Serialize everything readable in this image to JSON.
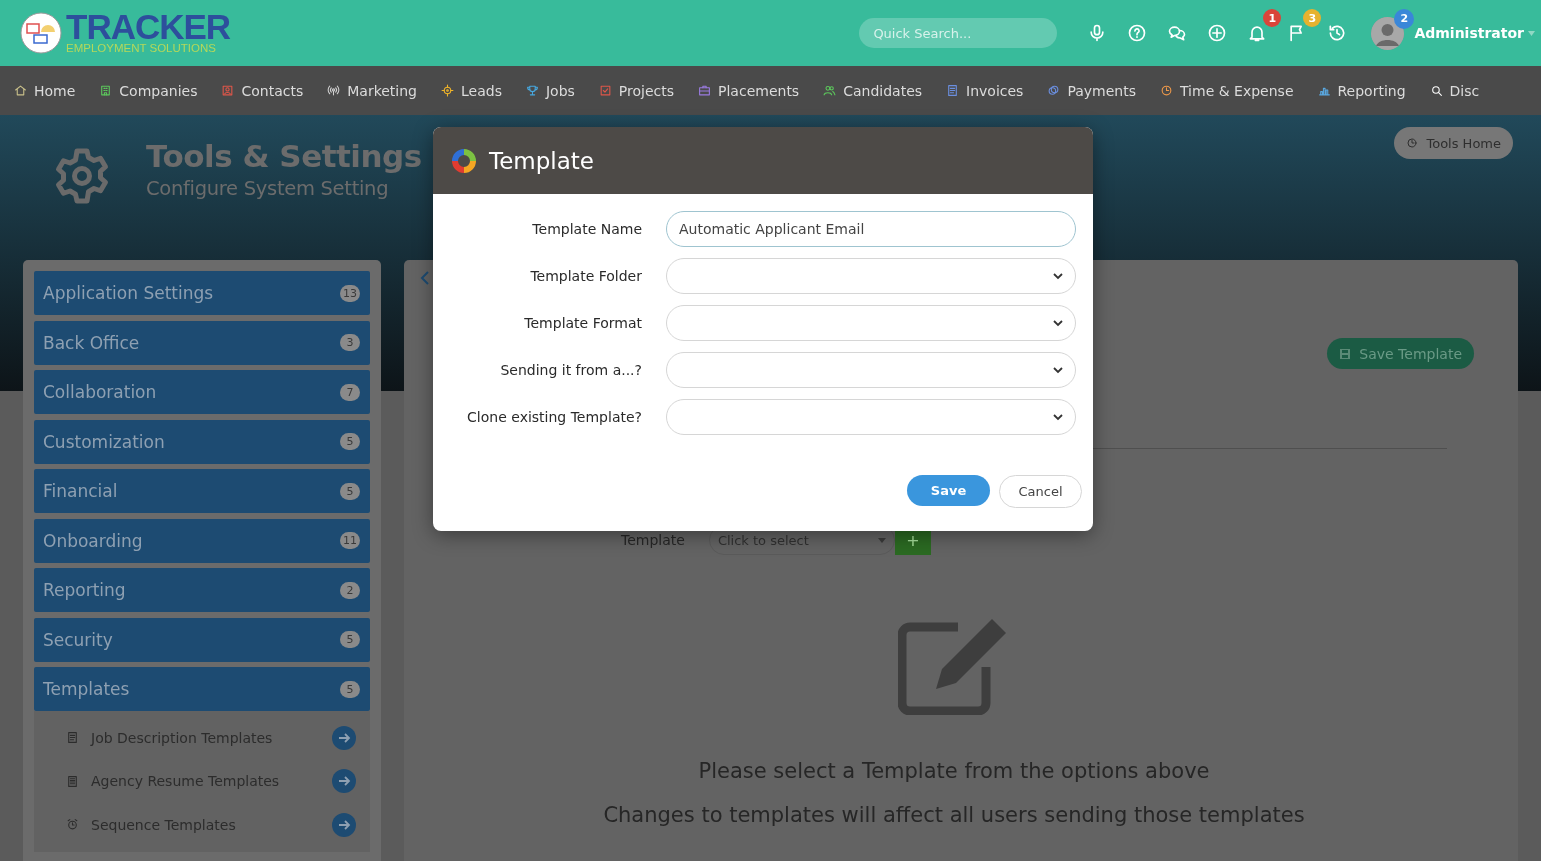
{
  "header": {
    "logo": {
      "title": "TRACKER",
      "subtitle": "EMPLOYMENT SOLUTIONS"
    },
    "search": {
      "placeholder": "Quick Search..."
    },
    "icons": [
      {
        "kind": "mic"
      },
      {
        "kind": "help"
      },
      {
        "kind": "chat"
      },
      {
        "kind": "add"
      },
      {
        "kind": "bell",
        "badge": "1",
        "color": "#d9453a"
      },
      {
        "kind": "flag",
        "badge": "3",
        "color": "#e6b22e"
      },
      {
        "kind": "history"
      }
    ],
    "user": {
      "name": "Administrator",
      "badge": "2"
    }
  },
  "nav": [
    {
      "label": "Home",
      "kind": "home"
    },
    {
      "label": "Companies",
      "kind": "building"
    },
    {
      "label": "Contacts",
      "kind": "contact"
    },
    {
      "label": "Marketing",
      "kind": "signal"
    },
    {
      "label": "Leads",
      "kind": "target"
    },
    {
      "label": "Jobs",
      "kind": "trophy"
    },
    {
      "label": "Projects",
      "kind": "check"
    },
    {
      "label": "Placements",
      "kind": "briefcase"
    },
    {
      "label": "Candidates",
      "kind": "people"
    },
    {
      "label": "Invoices",
      "kind": "doc"
    },
    {
      "label": "Payments",
      "kind": "coins"
    },
    {
      "label": "Time & Expense",
      "kind": "clock"
    },
    {
      "label": "Reporting",
      "kind": "chart"
    },
    {
      "label": "Disc",
      "kind": "search"
    }
  ],
  "hero": {
    "title": "Tools & Settings",
    "subtitle": "Configure System Setting",
    "tools_home": "Tools Home"
  },
  "sidebar": [
    {
      "label": "Application Settings",
      "badge": "13"
    },
    {
      "label": "Back Office",
      "badge": "3"
    },
    {
      "label": "Collaboration",
      "badge": "7"
    },
    {
      "label": "Customization",
      "badge": "5"
    },
    {
      "label": "Financial",
      "badge": "5"
    },
    {
      "label": "Onboarding",
      "badge": "11"
    },
    {
      "label": "Reporting",
      "badge": "2"
    },
    {
      "label": "Security",
      "badge": "5"
    },
    {
      "label": "Templates",
      "badge": "5",
      "children": [
        {
          "label": "Job Description Templates",
          "kind": "doc"
        },
        {
          "label": "Agency Resume Templates",
          "kind": "list"
        },
        {
          "label": "Sequence Templates",
          "kind": "alarm"
        }
      ]
    }
  ],
  "content": {
    "save_button": "Save Template",
    "picker": {
      "label": "Template",
      "placeholder": "Click to select",
      "add": "+"
    },
    "messages": [
      "Please select a Template from the options above",
      "Changes to templates will affect all users sending those templates"
    ]
  },
  "modal": {
    "title": "Template",
    "fields": [
      {
        "label": "Template Name",
        "kind": "text",
        "value": "Automatic Applicant Email"
      },
      {
        "label": "Template Folder",
        "kind": "select"
      },
      {
        "label": "Template Format",
        "kind": "select"
      },
      {
        "label": "Sending it from a...?",
        "kind": "select"
      },
      {
        "label": "Clone existing Template?",
        "kind": "select"
      }
    ],
    "save": "Save",
    "cancel": "Cancel"
  }
}
